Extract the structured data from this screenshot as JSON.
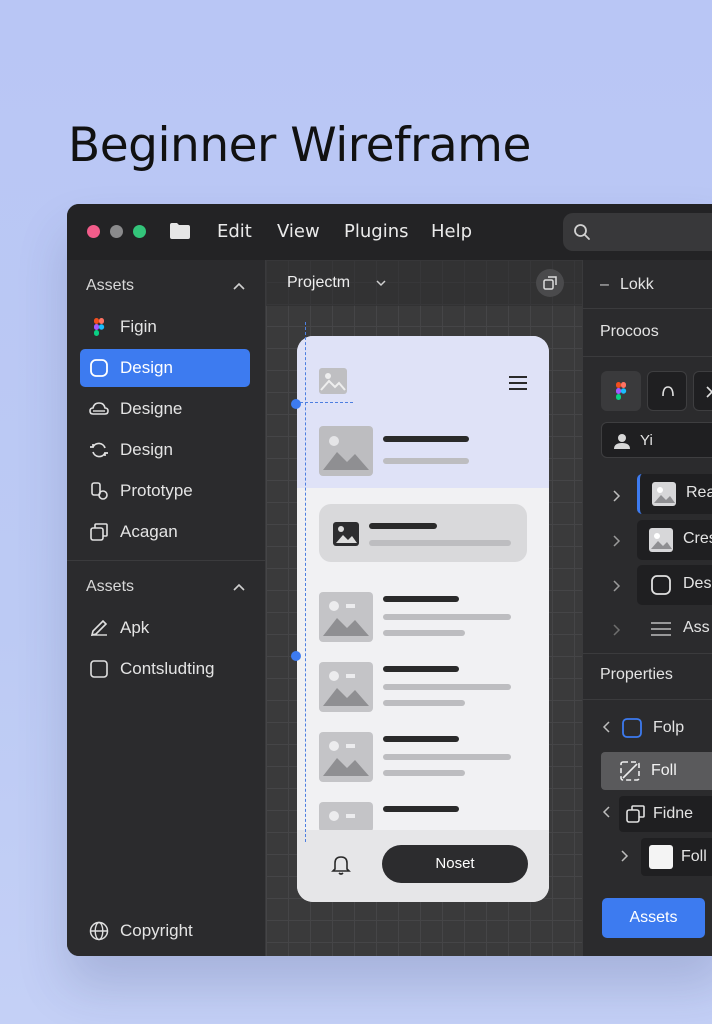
{
  "page": {
    "title": "Beginner Wireframe"
  },
  "colors": {
    "accent": "#3d7bf0",
    "window_bg": "#2a2a2c",
    "traffic_red": "#f25c8a",
    "traffic_gray": "#8a8a8c",
    "traffic_green": "#33c47a"
  },
  "menu": {
    "items": [
      "Edit",
      "View",
      "Plugins",
      "Help"
    ]
  },
  "search": {
    "icon": "search-icon"
  },
  "left_panel": {
    "section1_title": "Assets",
    "section1_items": [
      {
        "label": "Figin",
        "icon": "figma-icon"
      },
      {
        "label": "Design",
        "icon": "frame-icon",
        "active": true
      },
      {
        "label": "Designe",
        "icon": "cloud-icon"
      },
      {
        "label": "Design",
        "icon": "sync-icon"
      },
      {
        "label": "Prototype",
        "icon": "prototype-icon"
      },
      {
        "label": "Acagan",
        "icon": "copy-icon"
      }
    ],
    "section2_title": "Assets",
    "section2_items": [
      {
        "label": "Apk",
        "icon": "pen-icon"
      },
      {
        "label": "Contsludting",
        "icon": "square-icon"
      }
    ],
    "footer_label": "Copyright",
    "footer_icon": "globe-icon"
  },
  "canvas": {
    "title": "Projectm",
    "cta_label": "Noset"
  },
  "right_panel": {
    "header": "Lokk",
    "section_title": "Procoos",
    "input_value": "Yi",
    "layers": [
      {
        "label": "Rea",
        "icon": "image-icon"
      },
      {
        "label": "Cres",
        "icon": "image-icon"
      },
      {
        "label": "Des",
        "icon": "frame-icon"
      },
      {
        "label": "Ass",
        "icon": "menu-icon"
      }
    ],
    "properties_title": "Properties",
    "props": [
      {
        "label": "Folp",
        "icon": "frame-icon"
      },
      {
        "label": "Foll",
        "icon": "resize-icon"
      },
      {
        "label": "Fidne",
        "icon": "copy-icon"
      },
      {
        "label": "Foll",
        "icon": "square-icon"
      }
    ],
    "assets_button": "Assets"
  }
}
